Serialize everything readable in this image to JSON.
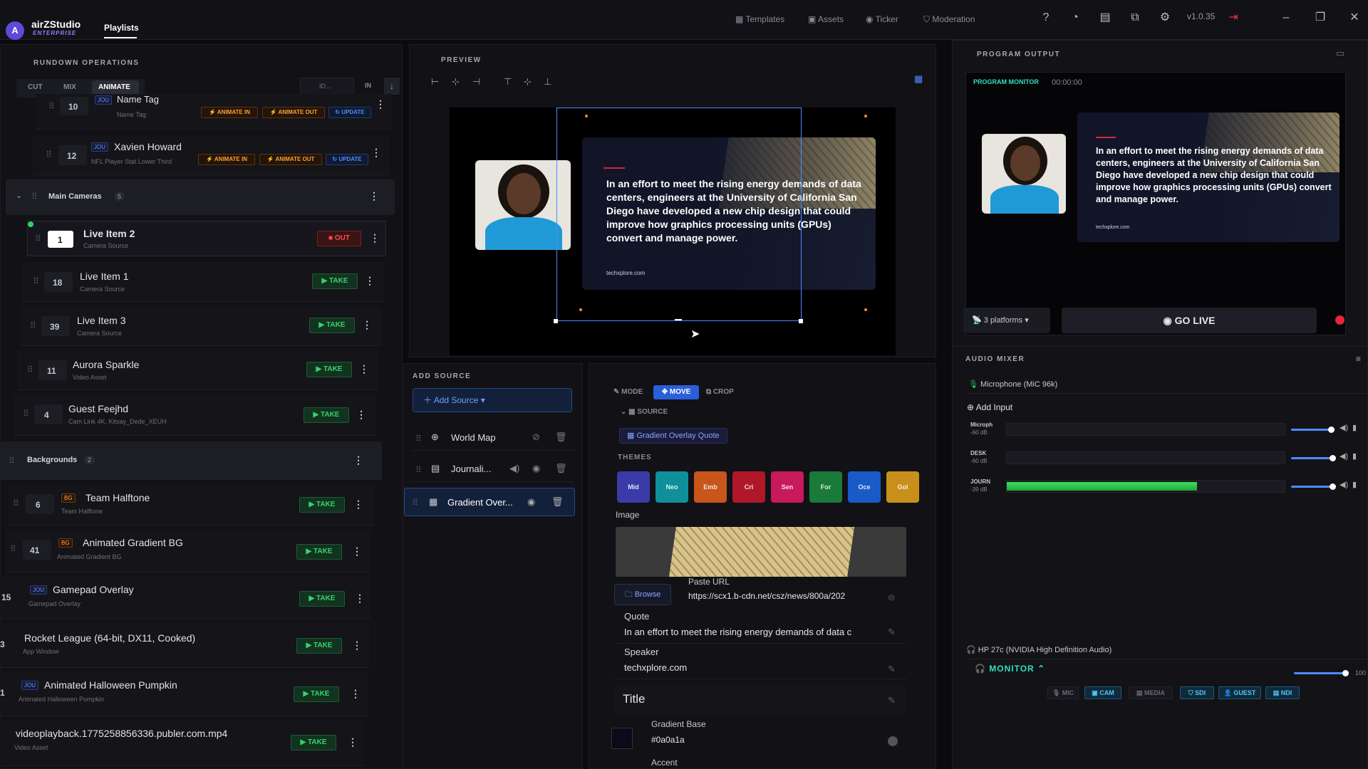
{
  "app": {
    "logo_letter": "A",
    "brand": "airZStudio",
    "edition": "ENTERPRISE",
    "nav_tab": "Playlists",
    "top_links": [
      "Templates",
      "Assets",
      "Ticker",
      "Moderation"
    ],
    "version": "v1.0.35"
  },
  "rundown": {
    "title": "RUNDOWN OPERATIONS",
    "modes": [
      "CUT",
      "MIX",
      "ANIMATE"
    ],
    "active_mode": "ANIMATE",
    "search_placeholder": "ID...",
    "in_label": "IN",
    "items_top": [
      {
        "num": "10",
        "tag": "JOU",
        "title": "Name Tag",
        "sub": "Name Tag",
        "btn_in": "ANIMATE IN",
        "btn_out": "ANIMATE OUT",
        "btn_update": "UPDATE"
      },
      {
        "num": "12",
        "tag": "JOU",
        "title": "Xavien Howard",
        "sub": "NFL Player Stat Lower Third",
        "btn_in": "ANIMATE IN",
        "btn_out": "ANIMATE OUT",
        "btn_update": "UPDATE"
      }
    ],
    "group_main": {
      "name": "Main Cameras",
      "count": "5"
    },
    "main_items": [
      {
        "num": "1",
        "title": "Live Item 2",
        "sub": "Camera Source",
        "action": "OUT"
      },
      {
        "num": "18",
        "title": "Live Item 1",
        "sub": "Camera Source",
        "action": "TAKE"
      },
      {
        "num": "39",
        "title": "Live Item 3",
        "sub": "Camera Source",
        "action": "TAKE"
      },
      {
        "num": "11",
        "title": "Aurora Sparkle",
        "sub": "Video Asset",
        "action": "TAKE"
      },
      {
        "num": "4",
        "title": "Guest Feejhd",
        "sub": "Cam Link 4K, Kitsay_Dede_XEUH",
        "action": "TAKE"
      }
    ],
    "group_bg": {
      "name": "Backgrounds",
      "count": "2"
    },
    "bg_items": [
      {
        "num": "6",
        "tag": "BG",
        "title": "Team Halftone",
        "sub": "Team Halftone",
        "action": "TAKE"
      },
      {
        "num": "41",
        "tag": "BG",
        "title": "Animated Gradient BG",
        "sub": "Animated Gradient BG",
        "action": "TAKE"
      }
    ],
    "other_items": [
      {
        "num": "15",
        "tag": "JOU",
        "title": "Gamepad Overlay",
        "sub": "Gamepad Overlay",
        "action": "TAKE"
      },
      {
        "num": "3",
        "tag": "",
        "title": "Rocket League (64-bit, DX11, Cooked)",
        "sub": "App Window",
        "action": "TAKE"
      },
      {
        "num": "1",
        "tag": "JOU",
        "title": "Animated Halloween Pumpkin",
        "sub": "Animated Halloween Pumpkin",
        "action": "TAKE"
      },
      {
        "num": "",
        "tag": "",
        "title": "videoplayback.1775258856336.publer.com.mp4",
        "sub": "Video Asset",
        "action": "TAKE"
      }
    ]
  },
  "preview": {
    "title": "PREVIEW",
    "quote": "In an effort to meet the rising energy demands of data centers, engineers at the University of California San Diego have developed a new chip design that could improve how graphics processing units (GPUs) convert and manage power.",
    "source": "techxplore.com"
  },
  "add_source": {
    "title": "ADD SOURCE",
    "button": "Add Source",
    "layers": [
      {
        "name": "World Map"
      },
      {
        "name": "Journali..."
      },
      {
        "name": "Gradient Over..."
      }
    ]
  },
  "props": {
    "mode_label": "MODE",
    "move_label": "MOVE",
    "crop_label": "CROP",
    "source_label": "SOURCE",
    "source_name": "Gradient Overlay Quote",
    "themes_label": "THEMES",
    "themes": [
      {
        "name": "Mid",
        "color": "#3a3aa8"
      },
      {
        "name": "Neo",
        "color": "#0f8f9a"
      },
      {
        "name": "Emb",
        "color": "#c8551a"
      },
      {
        "name": "Cri",
        "color": "#b0182a"
      },
      {
        "name": "Sen",
        "color": "#c81a5a"
      },
      {
        "name": "For",
        "color": "#1a7a3a"
      },
      {
        "name": "Oce",
        "color": "#1a5ac8"
      },
      {
        "name": "Gol",
        "color": "#c8901a"
      }
    ],
    "image_label": "Image",
    "browse": "Browse",
    "paste_url_label": "Paste URL",
    "paste_url": "https://scx1.b-cdn.net/csz/news/800a/202",
    "quote_label": "Quote",
    "quote_value": "In an effort to meet the rising energy demands of data c",
    "speaker_label": "Speaker",
    "speaker_value": "techxplore.com",
    "title_label": "Title",
    "gradient_label": "Gradient Base",
    "gradient_value": "#0a0a1a",
    "accent_label": "Accent"
  },
  "program": {
    "title": "PROGRAM OUTPUT",
    "monitor_label": "PROGRAM MONITOR",
    "timecode": "00:00:00",
    "platforms": "3 platforms",
    "go_live": "GO LIVE"
  },
  "audio": {
    "title": "AUDIO MIXER",
    "device": "Microphone (MiC 96k)",
    "add_input": "Add Input",
    "channels": [
      {
        "name": "Microph",
        "db": "-60 dB",
        "level": 0,
        "volume": 0.9
      },
      {
        "name": "DESK",
        "db": "-60 dB",
        "level": 0,
        "volume": 0.93
      },
      {
        "name": "JOURN",
        "db": "-39 dB",
        "level": 0.68,
        "volume": 0.93
      }
    ],
    "monitor_device": "HP 27c (NVIDIA High Definition Audio)",
    "monitor_label": "MONITOR",
    "monitor_volume_label": "100",
    "monitor_volume": 1.0,
    "pills": [
      "MIC",
      "CAM",
      "MEDIA",
      "SDI",
      "GUEST",
      "NDI"
    ]
  }
}
